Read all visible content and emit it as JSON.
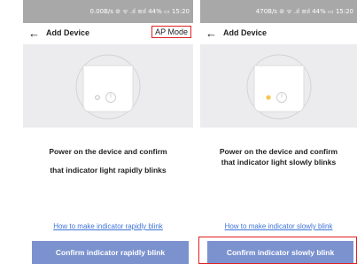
{
  "left_screen": {
    "status_text": "0.00B/s ⊘ ᯤ .ıl ≡ıl 44% ▭ 15:20",
    "back_icon": "arrow-left-icon",
    "title": "Add Device",
    "ap_mode_label": "AP Mode",
    "instruction_line1": "Power on the device and confirm",
    "instruction_line2": "that indicator light rapidly blinks",
    "help_link": "How to make indicator rapidly blink",
    "confirm_label": "Confirm indicator rapidly blink",
    "indicator_color": "#bdbdbd"
  },
  "right_screen": {
    "status_text": "470B/s ⊘ ᯤ .ıl ≡ıl 44% ▭ 15:20",
    "back_icon": "arrow-left-icon",
    "title": "Add Device",
    "instruction_line1": "Power on the device and confirm",
    "instruction_line2": "that indicator light slowly blinks",
    "help_link": "How to make indicator slowly blink",
    "confirm_label": "Confirm indicator slowly blink",
    "indicator_color": "#f2c94c"
  },
  "colors": {
    "status_bar": "#a8a8a8",
    "button": "#7b92cf",
    "link": "#3f74d8",
    "highlight": "#e02020",
    "illustration_bg": "#ececee"
  }
}
